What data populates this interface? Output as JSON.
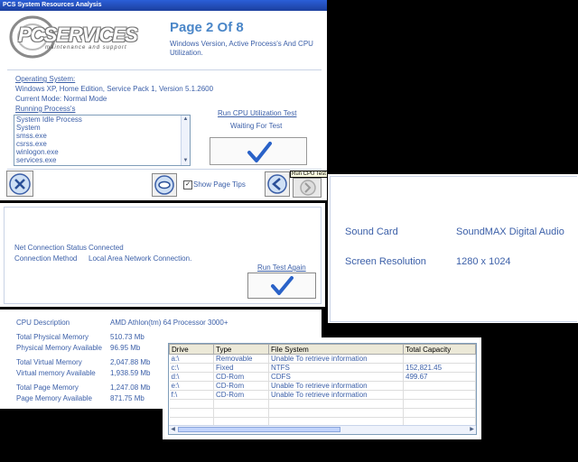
{
  "window": {
    "title": "PCS System Resources Analysis"
  },
  "logo": {
    "text": "PCSERVICES",
    "tagline": "maintenance and support"
  },
  "header": {
    "page_title": "Page 2 Of 8",
    "subtitle": "Windows Version, Active Process's And CPU Utilization."
  },
  "os": {
    "label": "Operating System:",
    "value": "Windows XP, Home Edition, Service Pack 1, Version 5.1.2600",
    "mode": "Current Mode: Normal Mode",
    "running_label": "Running Process's",
    "processes": [
      "System Idle Process",
      "System",
      "smss.exe",
      "csrss.exe",
      "winlogon.exe",
      "services.exe"
    ]
  },
  "cpu_test": {
    "link": "Run CPU Utilization Test",
    "status": "Waiting For Test"
  },
  "toolbar": {
    "show_tips": "Show Page Tips",
    "tips_checked": true,
    "run_cpu_test": "Run CPU Test"
  },
  "net": {
    "status_label": "Net Connection Status",
    "status_value": "Connected",
    "method_label": "Connection Method",
    "method_value": "Local Area Network Connection.",
    "run_again": "Run Test Again"
  },
  "hw": {
    "sound_label": "Sound Card",
    "sound_value": "SoundMAX Digital Audio",
    "res_label": "Screen Resolution",
    "res_value": "1280 x 1024"
  },
  "mem": {
    "cpu_label": "CPU Description",
    "cpu_value": "AMD Athlon(tm) 64 Processor 3000+",
    "tpm_label": "Total Physical Memory",
    "tpm_value": "510.73 Mb",
    "pma_label": "Physical Memory Available",
    "pma_value": "96.95 Mb",
    "tvm_label": "Total Virtual Memory",
    "tvm_value": "2,047.88 Mb",
    "vma_label": "Virtual memory Available",
    "vma_value": "1,938.59 Mb",
    "tpg_label": "Total Page Memory",
    "tpg_value": "1,247.08 Mb",
    "pga_label": "Page Memory Available",
    "pga_value": "871.75 Mb"
  },
  "drives": {
    "headers": [
      "Drive",
      "Type",
      "File System",
      "Total Capacity"
    ],
    "rows": [
      [
        "a:\\",
        "Removable",
        "Unable To retrieve information",
        ""
      ],
      [
        "c:\\",
        "Fixed",
        "NTFS",
        "152,821.45"
      ],
      [
        "d:\\",
        "CD-Rom",
        "CDFS",
        "499.67"
      ],
      [
        "e:\\",
        "CD-Rom",
        "Unable To retrieve information",
        ""
      ],
      [
        "f:\\",
        "CD-Rom",
        "Unable To retrieve information",
        ""
      ]
    ]
  },
  "colors": {
    "accent": "#3b5fa8",
    "title_blue": "#4a86c8",
    "check_blue": "#2a62c8"
  }
}
